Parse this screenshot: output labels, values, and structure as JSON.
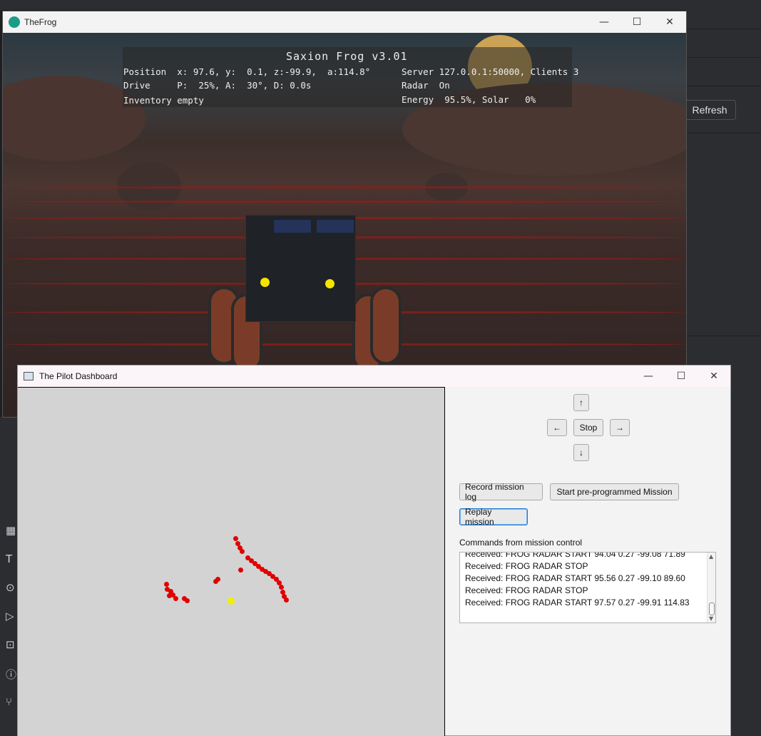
{
  "ide": {
    "refresh_label": "Refresh",
    "left_icons": [
      "plugin-icon",
      "text-icon",
      "services-icon",
      "run-icon",
      "terminal-icon",
      "problems-icon",
      "git-icon"
    ]
  },
  "frog_window": {
    "title": "TheFrog",
    "hud": {
      "title": "Saxion Frog v3.01",
      "position": "Position  x: 97.6, y:  0.1, z:-99.9,  a:114.8°",
      "drive": "Drive     P:  25%, A:  30°, D: 0.0s",
      "inventory": "Inventory empty",
      "server": "Server 127.0.0.1:50000, Clients 3",
      "radar": "Radar  On",
      "energy": "Energy  95.5%, Solar   0%"
    }
  },
  "pilot_window": {
    "title": "The Pilot Dashboard",
    "controls": {
      "up": "↑",
      "left": "←",
      "stop": "Stop",
      "right": "→",
      "down": "↓"
    },
    "buttons": {
      "record": "Record mission log",
      "start": "Start pre-programmed Mission",
      "replay": "Replay mission"
    },
    "log_label": "Commands from mission control",
    "log_lines": [
      "Received: FROG RADAR START 94.04 0.27 -99.08 71.89",
      "Received: FROG RADAR STOP",
      "Received: FROG RADAR START 95.56 0.27 -99.10 89.60",
      "Received: FROG RADAR STOP",
      "Received: FROG RADAR START 97.57 0.27 -99.91 114.83"
    ],
    "colors": {
      "radar_point": "#e00000",
      "frog_marker": "#f0f000",
      "map_bg": "#d3d3d3"
    }
  }
}
